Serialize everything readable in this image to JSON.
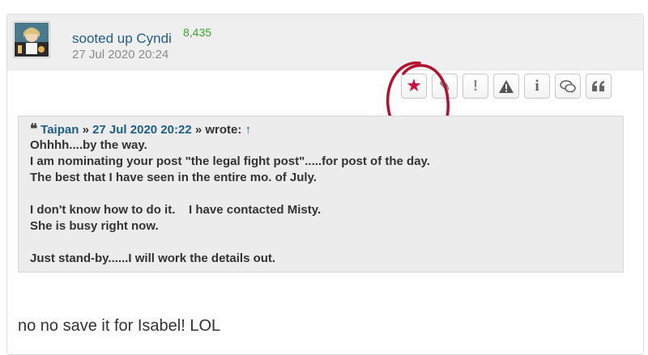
{
  "post": {
    "author": "sooted up Cyndi",
    "post_count": "8,435",
    "date": "27 Jul 2020 20:24",
    "actions": [
      {
        "name": "star-icon",
        "glyph": "★",
        "color": "#d0103a"
      },
      {
        "name": "pencil-icon",
        "glyph": "✎",
        "color": "#888888"
      },
      {
        "name": "exclamation-icon",
        "glyph": "!",
        "color": "#888888"
      },
      {
        "name": "warning-icon",
        "glyph": "⚠",
        "color": "#555555"
      },
      {
        "name": "info-icon",
        "glyph": "i",
        "color": "#666666"
      },
      {
        "name": "chat-bubbles-icon",
        "glyph": "💬",
        "color": "#666666"
      },
      {
        "name": "quote-icon",
        "glyph": "❝",
        "color": "#666666"
      }
    ],
    "quote": {
      "author": "Taipan",
      "sep1": "»",
      "date": "27 Jul 2020 20:22",
      "sep2": "»",
      "wrote": "wrote:",
      "arrow": "↑",
      "lines": [
        "Ohhhh....by the way.",
        "I am nominating your post \"the legal fight post\".....for post of the day.",
        "The best that I have seen in the entire mo. of July.",
        "",
        "I don't know how to do it.    I have contacted Misty.",
        "She is busy right now.",
        "",
        "Just stand-by......I will work the details out."
      ]
    },
    "reply": "no no save it for Isabel! LOL"
  },
  "colors": {
    "author_link": "#1f5d8a",
    "post_count": "#3aa62f",
    "annotation_circle": "#b5112f"
  }
}
